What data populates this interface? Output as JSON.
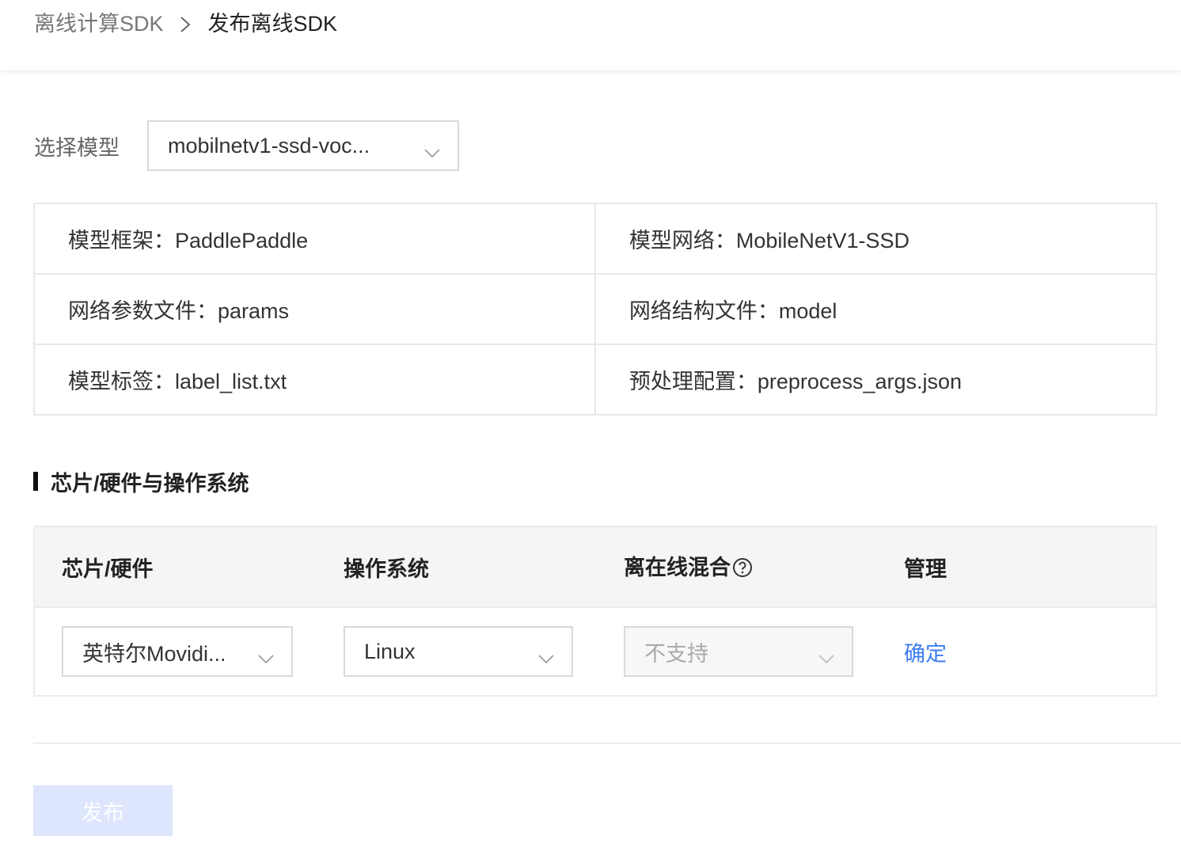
{
  "breadcrumb": {
    "parent": "离线计算SDK",
    "current": "发布离线SDK"
  },
  "model_select": {
    "label": "选择模型",
    "value": "mobilnetv1-ssd-voc..."
  },
  "model_info": {
    "framework": "模型框架：PaddlePaddle",
    "network": "模型网络：MobileNetV1-SSD",
    "params_file": "网络参数文件：params",
    "structure_file": "网络结构文件：model",
    "labels": "模型标签：label_list.txt",
    "preprocess": "预处理配置：preprocess_args.json"
  },
  "section": {
    "title": "芯片/硬件与操作系统"
  },
  "hw_table": {
    "headers": {
      "chip": "芯片/硬件",
      "os": "操作系统",
      "hybrid": "离在线混合",
      "manage": "管理"
    },
    "row": {
      "chip": "英特尔Movidi...",
      "os": "Linux",
      "hybrid": "不支持",
      "action": "确定"
    }
  },
  "publish_button": "发布",
  "colors": {
    "link": "#3c7ef2",
    "publish_disabled_bg": "#dde6fd",
    "header_bg": "#f5f5f5"
  },
  "icons": {
    "breadcrumb_separator": "chevron-right-icon",
    "dropdown": "chevron-down-icon",
    "help": "question-circle-icon"
  }
}
